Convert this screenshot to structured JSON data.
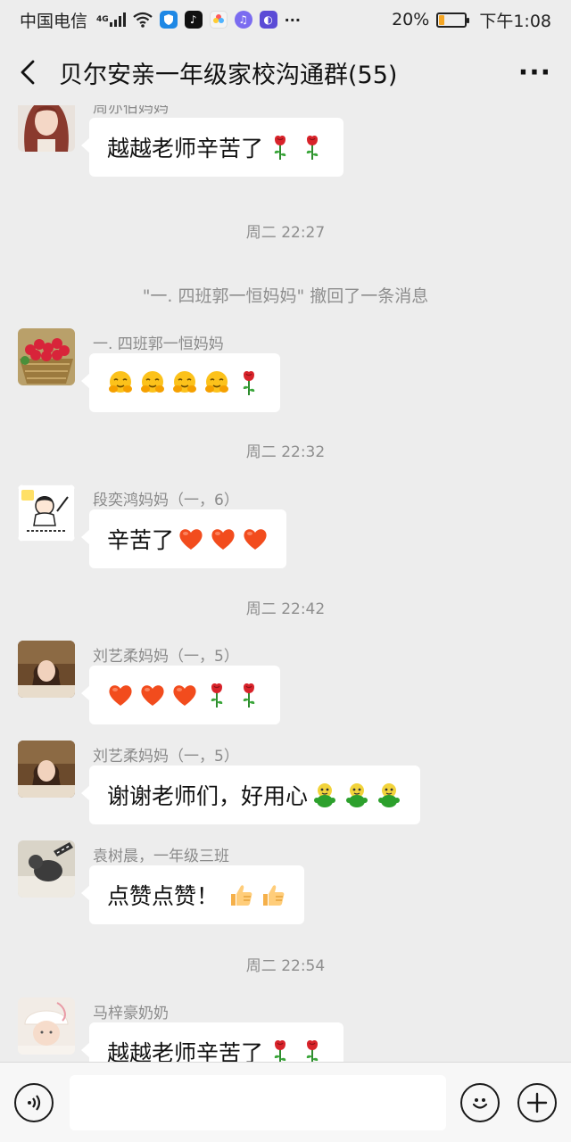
{
  "status_bar": {
    "carrier": "中国电信",
    "network": "4G",
    "battery_percent": "20%",
    "battery_level": 0.2,
    "time": "下午1:08"
  },
  "header": {
    "title": "贝尔安亲一年级家校沟通群(55)"
  },
  "messages": [
    {
      "sender": "周亦伯妈妈",
      "text": "越越老师辛苦了",
      "emojis": [
        "rose",
        "rose"
      ]
    },
    {
      "sender": "一. 四班郭一恒妈妈",
      "text": "",
      "emojis": [
        "hug",
        "hug",
        "hug",
        "hug",
        "rose"
      ]
    },
    {
      "sender": "段奕鸿妈妈（一，6）",
      "text": "辛苦了",
      "emojis": [
        "heart",
        "heart",
        "heart"
      ]
    },
    {
      "sender": "刘艺柔妈妈（一，5）",
      "text": "",
      "emojis": [
        "heart",
        "heart",
        "heart",
        "rose",
        "rose"
      ]
    },
    {
      "sender": "刘艺柔妈妈（一，5）",
      "text": "谢谢老师们，好用心",
      "emojis": [
        "green-figure",
        "green-figure",
        "green-figure"
      ]
    },
    {
      "sender": "袁树晨，一年级三班",
      "text": "点赞点赞！",
      "emojis": [
        "thumbs-up",
        "thumbs-up"
      ]
    },
    {
      "sender": "马梓豪奶奶",
      "text": "越越老师辛苦了",
      "emojis": [
        "rose",
        "rose"
      ]
    }
  ],
  "timestamps": [
    "周二 22:27",
    "周二 22:32",
    "周二 22:42",
    "周二 22:54"
  ],
  "system_message": "\"一. 四班郭一恒妈妈\" 撤回了一条消息",
  "input": {
    "placeholder": "",
    "voice_icon": "voice-icon",
    "emoji_icon": "emoji-face-icon",
    "plus_icon": "plus-icon"
  }
}
